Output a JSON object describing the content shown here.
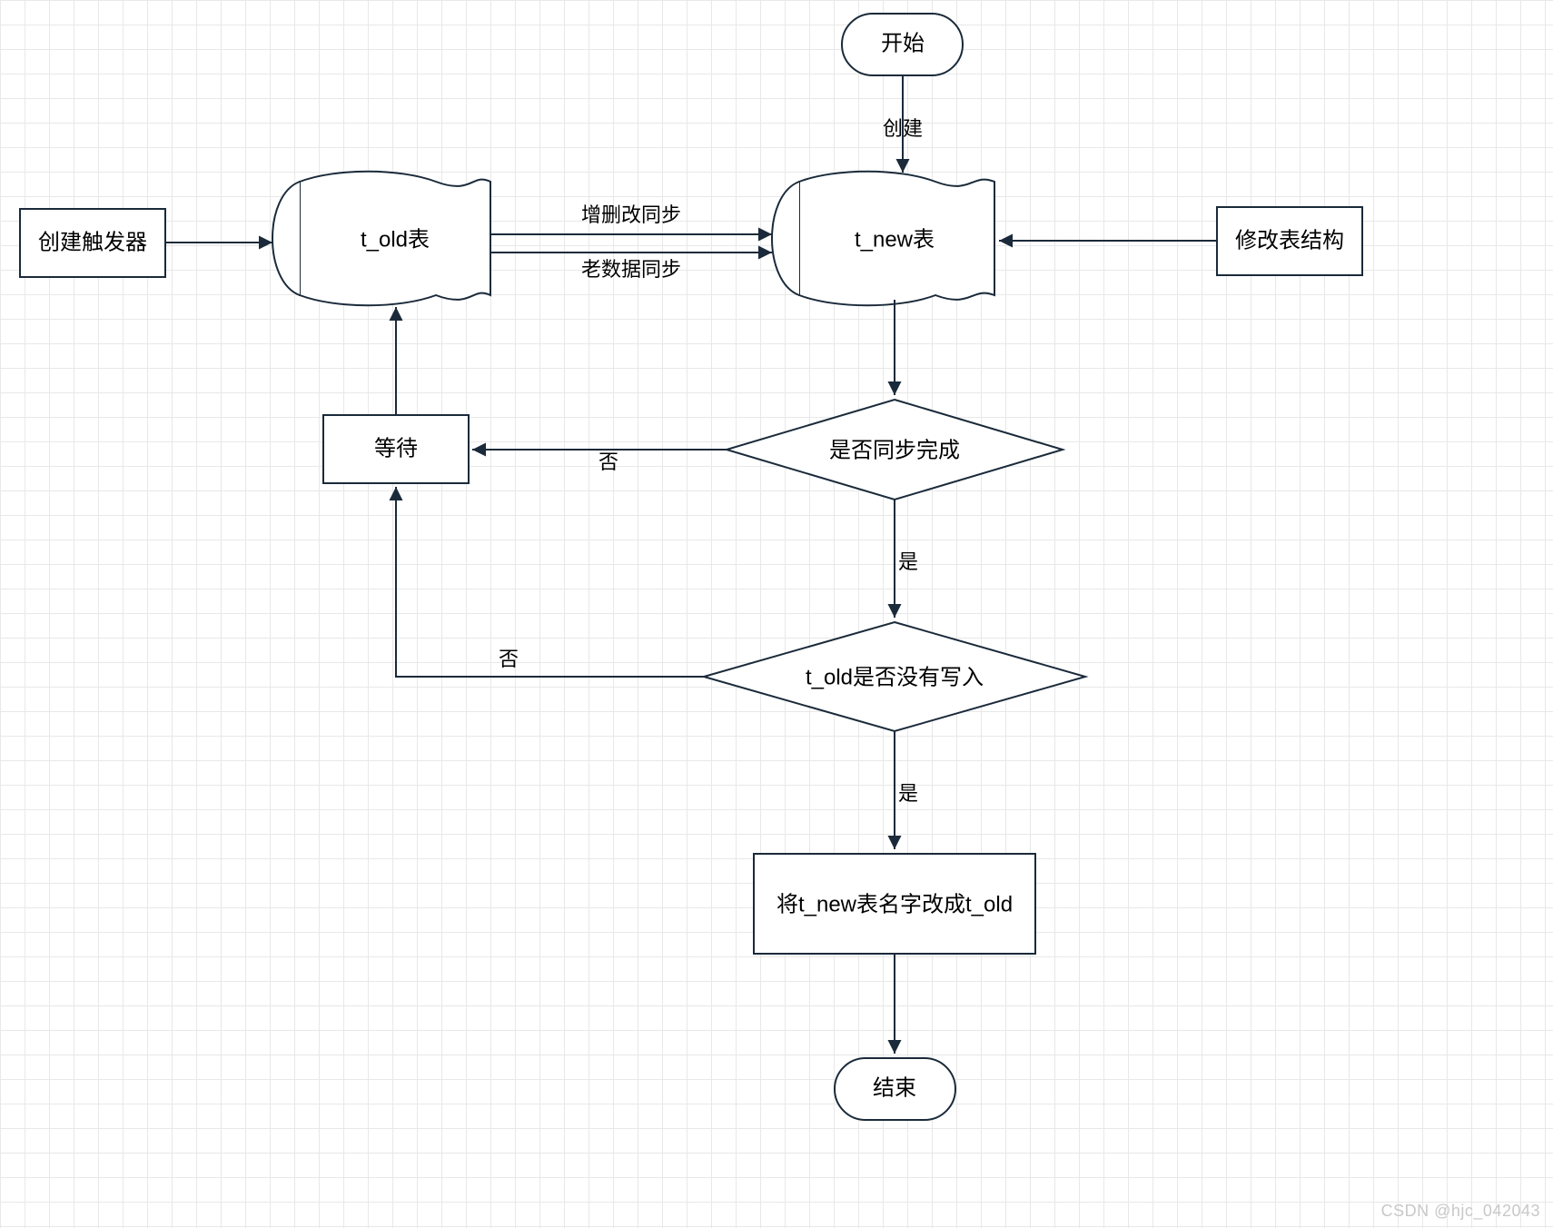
{
  "nodes": {
    "start": {
      "label": "开始"
    },
    "create_trigger": {
      "label": "创建触发器"
    },
    "t_old": {
      "label": "t_old表"
    },
    "t_new": {
      "label": "t_new表"
    },
    "alter_schema": {
      "label": "修改表结构"
    },
    "wait": {
      "label": "等待"
    },
    "decision_sync": {
      "label": "是否同步完成"
    },
    "decision_write": {
      "label": "t_old是否没有写入"
    },
    "rename": {
      "label": "将t_new表名字改成t_old"
    },
    "end": {
      "label": "结束"
    }
  },
  "edges": {
    "create": {
      "label": "创建"
    },
    "sync_iud": {
      "label": "增删改同步"
    },
    "sync_old": {
      "label": "老数据同步"
    },
    "no1": {
      "label": "否"
    },
    "yes1": {
      "label": "是"
    },
    "no2": {
      "label": "否"
    },
    "yes2": {
      "label": "是"
    }
  },
  "watermark": "CSDN @hjc_042043"
}
